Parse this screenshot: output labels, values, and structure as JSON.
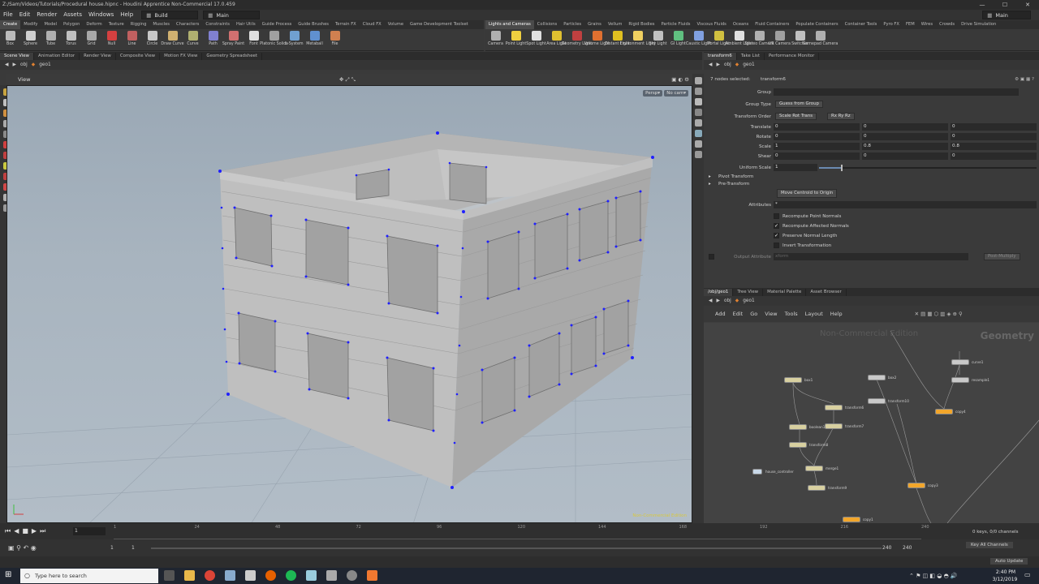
{
  "window": {
    "title": "Z:/Sam/Videos/Tutorials/Procedural house.hipnc - Houdini Apprentice Non-Commercial 17.0.459",
    "controls": [
      "—",
      "☐",
      "✕"
    ]
  },
  "menu": {
    "items": [
      "File",
      "Edit",
      "Render",
      "Assets",
      "Windows",
      "Help"
    ],
    "desktop": "Build",
    "desktop2": "Main",
    "right_desktop": "Main"
  },
  "shelf_left": {
    "tabs": [
      "Create",
      "Modify",
      "Model",
      "Polygon",
      "Deform",
      "Texture",
      "Rigging",
      "Muscles",
      "Characters",
      "Constraints",
      "Hair Utils",
      "Guide Process",
      "Guide Brushes",
      "Terrain FX",
      "Cloud FX",
      "Volume",
      "Game Development Toolset"
    ],
    "tools": [
      {
        "label": "Box",
        "color": "#bbbbbb"
      },
      {
        "label": "Sphere",
        "color": "#cfcfcf"
      },
      {
        "label": "Tube",
        "color": "#b0b0b0"
      },
      {
        "label": "Torus",
        "color": "#c0c0c0"
      },
      {
        "label": "Grid",
        "color": "#a8a8a8"
      },
      {
        "label": "Null",
        "color": "#d44040"
      },
      {
        "label": "Line",
        "color": "#c06060"
      },
      {
        "label": "Circle",
        "color": "#c8c8c8"
      },
      {
        "label": "Draw Curve",
        "color": "#d0b070"
      },
      {
        "label": "Curve",
        "color": "#b0b070"
      },
      {
        "label": "Path",
        "color": "#8080d0"
      },
      {
        "label": "Spray Paint",
        "color": "#d07070"
      },
      {
        "label": "Font",
        "color": "#e0e0e0"
      },
      {
        "label": "Platonic Solids",
        "color": "#a0a0a0"
      },
      {
        "label": "L-System",
        "color": "#70a0d0"
      },
      {
        "label": "Metaball",
        "color": "#6090d0"
      },
      {
        "label": "File",
        "color": "#d08050"
      }
    ]
  },
  "shelf_right": {
    "tabs": [
      "Lights and Cameras",
      "Collisions",
      "Particles",
      "Grains",
      "Vellum",
      "Rigid Bodies",
      "Particle Fluids",
      "Viscous Fluids",
      "Oceans",
      "Fluid Containers",
      "Populate Containers",
      "Container Tools",
      "Pyro FX",
      "FEM",
      "Wires",
      "Crowds",
      "Drive Simulation"
    ],
    "tools": [
      {
        "label": "Camera",
        "color": "#b0b0b0"
      },
      {
        "label": "Point Light",
        "color": "#f0d040"
      },
      {
        "label": "Spot Light",
        "color": "#e0e0e0"
      },
      {
        "label": "Area Light",
        "color": "#e0c030"
      },
      {
        "label": "Geometry Light",
        "color": "#c04040"
      },
      {
        "label": "Volume Light",
        "color": "#e07030"
      },
      {
        "label": "Distant Light",
        "color": "#e0c020"
      },
      {
        "label": "Environment Light",
        "color": "#f0d060"
      },
      {
        "label": "Sky Light",
        "color": "#c0c0c0"
      },
      {
        "label": "GI Light",
        "color": "#60c080"
      },
      {
        "label": "Caustic Light",
        "color": "#80a0e0"
      },
      {
        "label": "Portal Light",
        "color": "#d0c040"
      },
      {
        "label": "Ambient Light",
        "color": "#e0e0e0"
      },
      {
        "label": "Stereo Camera",
        "color": "#b0b0b0"
      },
      {
        "label": "VR Camera",
        "color": "#a0a0a0"
      },
      {
        "label": "Switcher",
        "color": "#c0c0c0"
      },
      {
        "label": "Gamepad Camera",
        "color": "#b0b0b0"
      }
    ]
  },
  "viewer": {
    "tabs": [
      "Scene View",
      "Animation Editor",
      "Render View",
      "Composite View",
      "Motion FX View",
      "Geometry Spreadsheet"
    ],
    "path": [
      "obj",
      "geo1"
    ],
    "title": "View",
    "persp": "Persp▾",
    "cam": "No cam▾",
    "watermark": "Non-Commercial Edition"
  },
  "param": {
    "tabs": [
      "transform6",
      "Take List",
      "Performance Monitor"
    ],
    "path": [
      "obj",
      "geo1"
    ],
    "selected_label": "7 nodes selected:",
    "selected_node": "transform6",
    "group_label": "Group",
    "group_type_label": "Group Type",
    "group_type_value": "Guess from Group",
    "order_label": "Transform Order",
    "order_value": "Scale Rot Trans",
    "rot_value": "Rx Ry Rz",
    "translate": {
      "label": "Translate",
      "values": [
        "0",
        "0",
        "0"
      ]
    },
    "rotate": {
      "label": "Rotate",
      "values": [
        "0",
        "0",
        "0"
      ]
    },
    "scale": {
      "label": "Scale",
      "values": [
        "1",
        "0.8",
        "0.8"
      ]
    },
    "shear": {
      "label": "Shear",
      "values": [
        "0",
        "0",
        "0"
      ]
    },
    "uniform_scale": {
      "label": "Uniform Scale",
      "value": "1",
      "fraction": 0.1
    },
    "pivot_label": "Pivot Transform",
    "pre_label": "Pre-Transform",
    "move_centroid": "Move Centroid to Origin",
    "attributes_label": "Attributes",
    "attributes_value": "*",
    "checks": [
      {
        "label": "Recompute Point Normals",
        "checked": false
      },
      {
        "label": "Recompute Affected Normals",
        "checked": true
      },
      {
        "label": "Preserve Normal Length",
        "checked": true
      },
      {
        "label": "Invert Transformation",
        "checked": false
      }
    ],
    "output_label": "Output Attribute",
    "output_value": "xform",
    "output_mode": "Post-Multiply"
  },
  "network": {
    "tabs": [
      "/obj/geo1",
      "Tree View",
      "Material Palette",
      "Asset Browser"
    ],
    "path": [
      "obj",
      "geo1"
    ],
    "menu": [
      "Add",
      "Edit",
      "Go",
      "View",
      "Tools",
      "Layout",
      "Help"
    ],
    "watermark": "Non-Commercial Edition",
    "context": "Geometry",
    "nodes": [
      {
        "name": "box1",
        "kind": "yellow"
      },
      {
        "name": "box2",
        "kind": "gray"
      },
      {
        "name": "transform6",
        "kind": "yellow"
      },
      {
        "name": "boolean1",
        "kind": "gray"
      },
      {
        "name": "transform7",
        "kind": "yellow"
      },
      {
        "name": "transform8",
        "kind": "yellow"
      },
      {
        "name": "transform10",
        "kind": "gray"
      },
      {
        "name": "merge1",
        "kind": "yellow"
      },
      {
        "name": "transform9",
        "kind": "yellow"
      },
      {
        "name": "house_controller",
        "kind": "gray"
      },
      {
        "name": "curve1",
        "kind": "gray"
      },
      {
        "name": "resample1",
        "kind": "gray"
      },
      {
        "name": "copy4",
        "kind": "orange"
      },
      {
        "name": "copy3",
        "kind": "orange"
      },
      {
        "name": "copy1",
        "kind": "orange"
      }
    ]
  },
  "timeline": {
    "ticks": [
      "1",
      "24",
      "48",
      "72",
      "96",
      "120",
      "144",
      "168",
      "192",
      "216",
      "240"
    ],
    "current_frame": "1",
    "start": "1",
    "start2": "1",
    "end": "240",
    "end2": "240",
    "keys": "0 keys, 0/0 channels",
    "key_all": "Key All Channels",
    "auto_update": "Auto Update"
  },
  "taskbar": {
    "search": "Type here to search",
    "time": "2:40 PM",
    "date": "3/12/2019"
  }
}
